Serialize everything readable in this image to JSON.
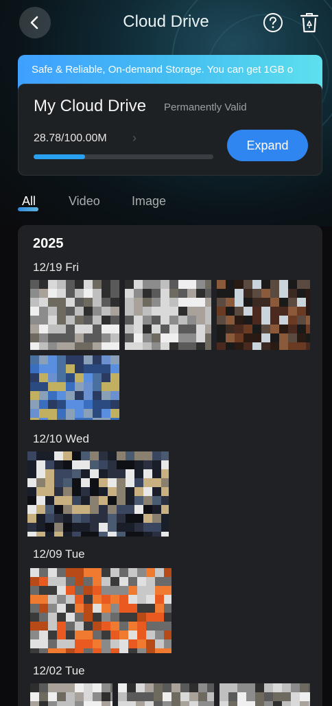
{
  "header": {
    "title": "Cloud Drive"
  },
  "banner": {
    "text": "Safe & Reliable, On-demand Storage. You can get 1GB o"
  },
  "storage": {
    "title": "My Cloud Drive",
    "validity": "Permanently Valid",
    "usage": "28.78/100.00M",
    "used_fraction": 0.2878,
    "expand_label": "Expand"
  },
  "tabs": [
    {
      "label": "All",
      "active": true
    },
    {
      "label": "Video",
      "active": false
    },
    {
      "label": "Image",
      "active": false
    }
  ],
  "gallery": {
    "year": "2025",
    "groups": [
      {
        "date": "12/19 Fri",
        "thumb_count": 4
      },
      {
        "date": "12/10 Wed",
        "thumb_count": 2
      },
      {
        "date": "12/09 Tue",
        "thumb_count": 1
      },
      {
        "date": "12/02 Tue",
        "thumb_count": 3
      }
    ]
  },
  "colors": {
    "accent": "#2f86f0",
    "progress": "#2aa0f0",
    "card": "#1e2124"
  }
}
